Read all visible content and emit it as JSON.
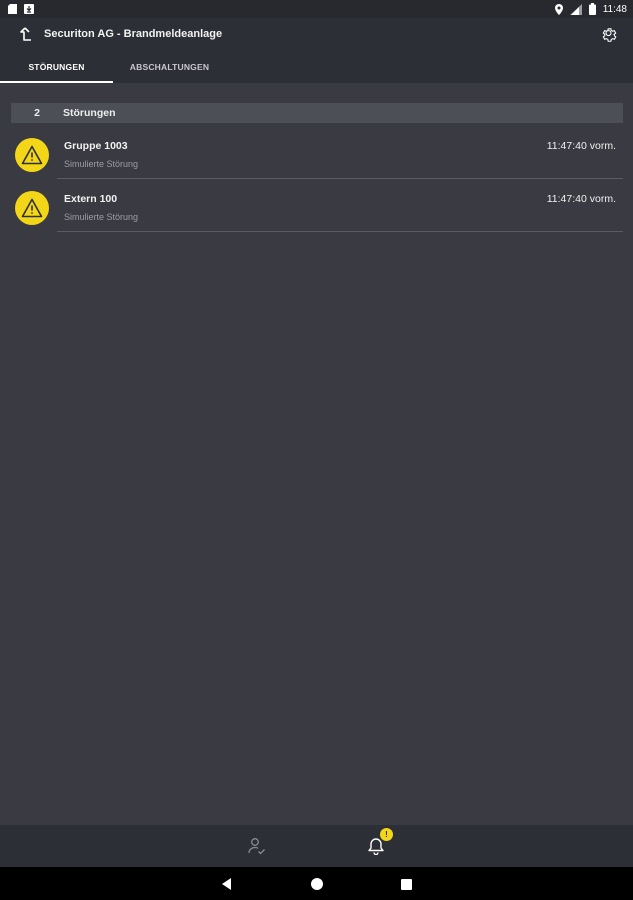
{
  "status_bar": {
    "time": "11:48",
    "left_icons": [
      "sd-card-icon",
      "download-icon"
    ],
    "right_icons": [
      "location-icon",
      "signal-icon",
      "battery-icon"
    ]
  },
  "app_bar": {
    "title": "Securiton AG - Brandmeldeanlage",
    "up_icon": "up-arrow-icon",
    "settings_icon": "gear-icon"
  },
  "tabs": [
    {
      "label": "STÖRUNGEN",
      "active": true
    },
    {
      "label": "ABSCHALTUNGEN",
      "active": false
    }
  ],
  "section": {
    "count": "2",
    "label": "Störungen"
  },
  "items": [
    {
      "title": "Gruppe 1003",
      "subtitle": "Simulierte Störung",
      "time": "11:47:40 vorm.",
      "icon": "warning-icon"
    },
    {
      "title": "Extern 100",
      "subtitle": "Simulierte Störung",
      "time": "11:47:40 vorm.",
      "icon": "warning-icon"
    }
  ],
  "bottom_nav": {
    "items": [
      {
        "icon": "person-check-icon",
        "active": false
      },
      {
        "icon": "bell-icon",
        "active": true,
        "badge": "!"
      }
    ]
  },
  "colors": {
    "accent": "#f3d617",
    "background": "#3a3b42",
    "bar": "#2d2f36",
    "section_header": "#4d4f57"
  }
}
